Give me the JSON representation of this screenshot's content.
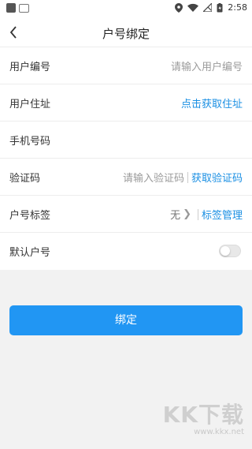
{
  "status_bar": {
    "time": "2:58"
  },
  "header": {
    "title": "户号绑定"
  },
  "form": {
    "user_id": {
      "label": "用户编号",
      "placeholder": "请输入用户编号"
    },
    "address": {
      "label": "用户住址",
      "action": "点击获取住址"
    },
    "phone": {
      "label": "手机号码"
    },
    "code": {
      "label": "验证码",
      "placeholder": "请输入验证码",
      "action": "获取验证码"
    },
    "tag": {
      "label": "户号标签",
      "value": "无",
      "action": "标签管理"
    },
    "default": {
      "label": "默认户号",
      "enabled": false
    }
  },
  "submit": {
    "label": "绑定"
  },
  "watermark": {
    "brand": "KK下载",
    "url": "www.kkx.net"
  }
}
